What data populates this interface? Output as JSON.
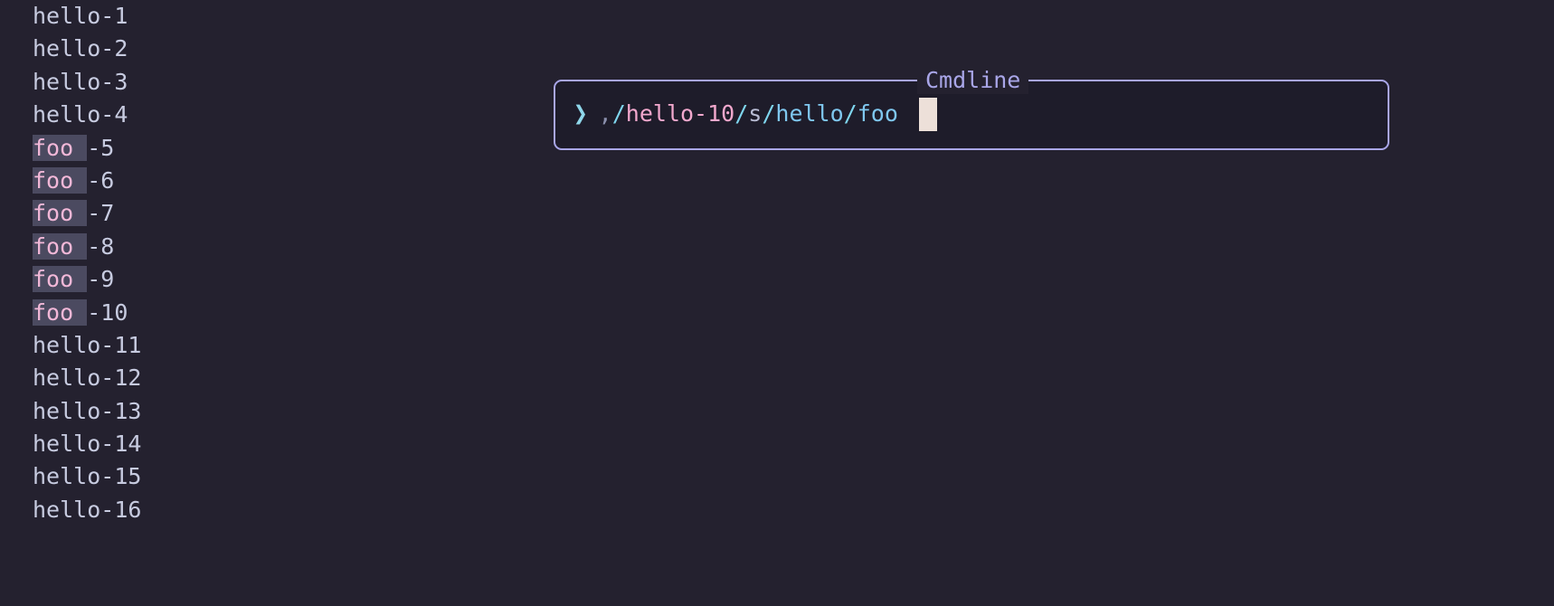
{
  "theme": {
    "background": "#24212f",
    "popup_background": "#1e1c2a",
    "border": "#a9a6e8",
    "text": "#c7cbe0",
    "match_text": "#f2b8d8",
    "match_highlight_bg": "#4b4a60",
    "cursor": "#ede0d9",
    "prompt": "#8fd7ea",
    "title": "#a9a6e8"
  },
  "buffer": {
    "name": "text-buffer",
    "lines": [
      {
        "prefix": "hello",
        "prefix_highlighted": false,
        "suffix": "-1"
      },
      {
        "prefix": "hello",
        "prefix_highlighted": false,
        "suffix": "-2"
      },
      {
        "prefix": "hello",
        "prefix_highlighted": false,
        "suffix": "-3"
      },
      {
        "prefix": "hello",
        "prefix_highlighted": false,
        "suffix": "-4"
      },
      {
        "prefix": "foo ",
        "prefix_highlighted": true,
        "suffix": "-5"
      },
      {
        "prefix": "foo ",
        "prefix_highlighted": true,
        "suffix": "-6"
      },
      {
        "prefix": "foo ",
        "prefix_highlighted": true,
        "suffix": "-7"
      },
      {
        "prefix": "foo ",
        "prefix_highlighted": true,
        "suffix": "-8"
      },
      {
        "prefix": "foo ",
        "prefix_highlighted": true,
        "suffix": "-9"
      },
      {
        "prefix": "foo ",
        "prefix_highlighted": true,
        "suffix": "-10"
      },
      {
        "prefix": "hello",
        "prefix_highlighted": false,
        "suffix": "-11"
      },
      {
        "prefix": "hello",
        "prefix_highlighted": false,
        "suffix": "-12"
      },
      {
        "prefix": "hello",
        "prefix_highlighted": false,
        "suffix": "-13"
      },
      {
        "prefix": "hello",
        "prefix_highlighted": false,
        "suffix": "-14"
      },
      {
        "prefix": "hello",
        "prefix_highlighted": false,
        "suffix": "-15"
      },
      {
        "prefix": "hello",
        "prefix_highlighted": false,
        "suffix": "-16"
      }
    ]
  },
  "cmdline": {
    "title": "Cmdline",
    "prompt_icon": "chevron-right-icon",
    "prompt_glyph": "❯",
    "full_text": ",/hello-10/s/hello/foo ",
    "segments": [
      {
        "text": ",",
        "role": "range-separator"
      },
      {
        "text": "/",
        "role": "delimiter"
      },
      {
        "text": "hello-10",
        "role": "search-pattern"
      },
      {
        "text": "/",
        "role": "delimiter"
      },
      {
        "text": "s",
        "role": "command"
      },
      {
        "text": "/",
        "role": "delimiter"
      },
      {
        "text": "hello",
        "role": "substitute-pattern"
      },
      {
        "text": "/",
        "role": "delimiter"
      },
      {
        "text": "foo",
        "role": "substitute-replacement"
      }
    ],
    "cursor_visible": true
  }
}
